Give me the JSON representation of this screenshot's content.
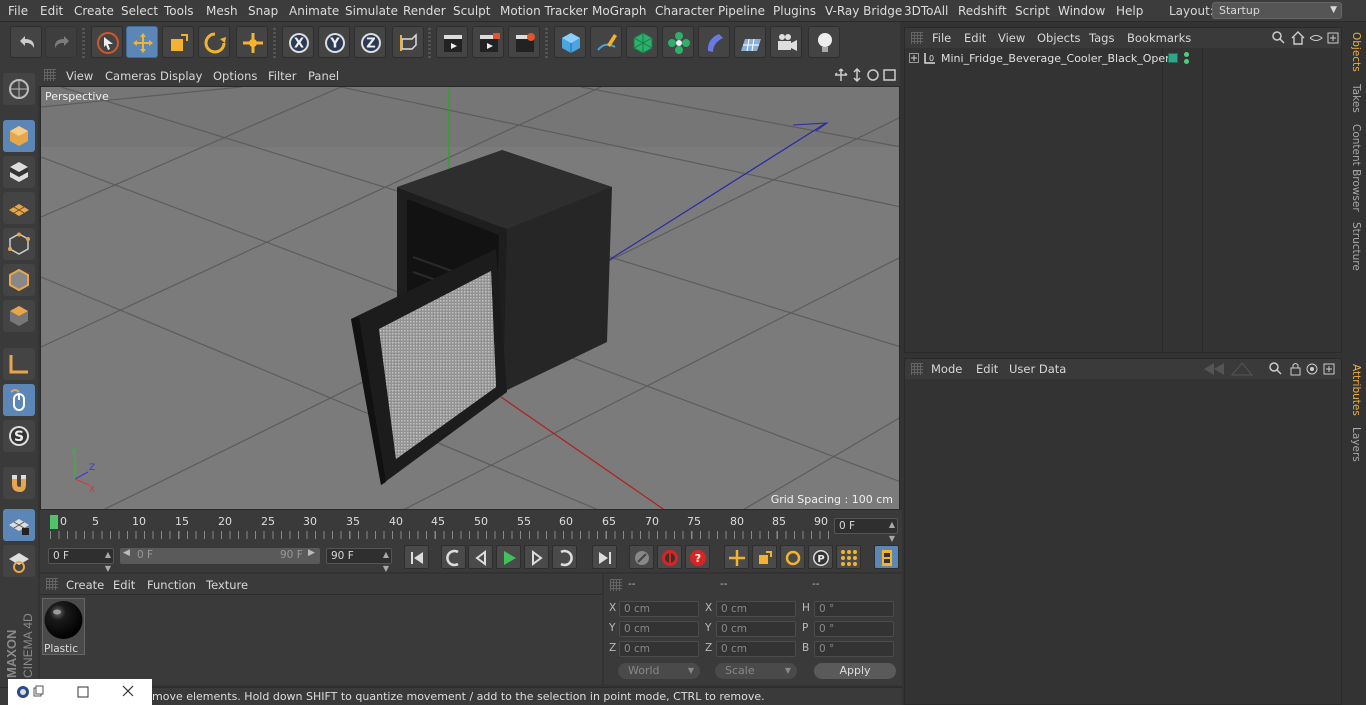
{
  "menubar": {
    "items": [
      "File",
      "Edit",
      "Create",
      "Select",
      "Tools",
      "Mesh",
      "Snap",
      "Animate",
      "Simulate",
      "Render",
      "Sculpt",
      "Motion Tracker",
      "MoGraph",
      "Character",
      "Pipeline",
      "Plugins",
      "V-Ray Bridge",
      "3DToAll",
      "Redshift",
      "Script",
      "Window",
      "Help"
    ],
    "layout_label": "Layout:",
    "layout_value": "Startup"
  },
  "viewport": {
    "menu": [
      "View",
      "Cameras",
      "Display",
      "Options",
      "Filter",
      "Panel"
    ],
    "camera_label": "Perspective",
    "grid_spacing": "Grid Spacing : 100 cm"
  },
  "timeline": {
    "ticks": [
      "0",
      "5",
      "10",
      "15",
      "20",
      "25",
      "30",
      "35",
      "40",
      "45",
      "50",
      "55",
      "60",
      "65",
      "70",
      "75",
      "80",
      "85",
      "90"
    ],
    "current_frame": "0 F",
    "start_field": "0 F",
    "range_start": "0 F",
    "range_end": "90 F",
    "end_field": "90 F"
  },
  "materials": {
    "menu": [
      "Create",
      "Edit",
      "Function",
      "Texture"
    ],
    "items": [
      {
        "name": "Plastic"
      }
    ]
  },
  "coordinates": {
    "headers": [
      "--",
      "--",
      "--"
    ],
    "rows": [
      {
        "l1": "X",
        "v1": "0 cm",
        "l2": "X",
        "v2": "0 cm",
        "l3": "H",
        "v3": "0 °"
      },
      {
        "l1": "Y",
        "v1": "0 cm",
        "l2": "Y",
        "v2": "0 cm",
        "l3": "P",
        "v3": "0 °"
      },
      {
        "l1": "Z",
        "v1": "0 cm",
        "l2": "Z",
        "v2": "0 cm",
        "l3": "B",
        "v3": "0 °"
      }
    ],
    "space": "World",
    "mode": "Scale",
    "apply_label": "Apply"
  },
  "status": {
    "text": "move elements. Hold down SHIFT to quantize movement / add to the selection in point mode, CTRL to remove."
  },
  "objects": {
    "menu": [
      "File",
      "Edit",
      "View",
      "Objects",
      "Tags",
      "Bookmarks"
    ],
    "items": [
      {
        "name": "Mini_Fridge_Beverage_Cooler_Black_Open"
      }
    ]
  },
  "attributes": {
    "menu": [
      "Mode",
      "Edit",
      "User Data"
    ]
  },
  "sidetabs": [
    "Objects",
    "Takes",
    "Content Browser",
    "Structure",
    "Attributes",
    "Layers"
  ],
  "brand": {
    "maker": "MAXON",
    "product": "CINEMA 4D"
  },
  "colors": {
    "accent": "#5b86b6",
    "active_tab": "#f0b040",
    "viewport_bg": "#7b7b7b"
  }
}
